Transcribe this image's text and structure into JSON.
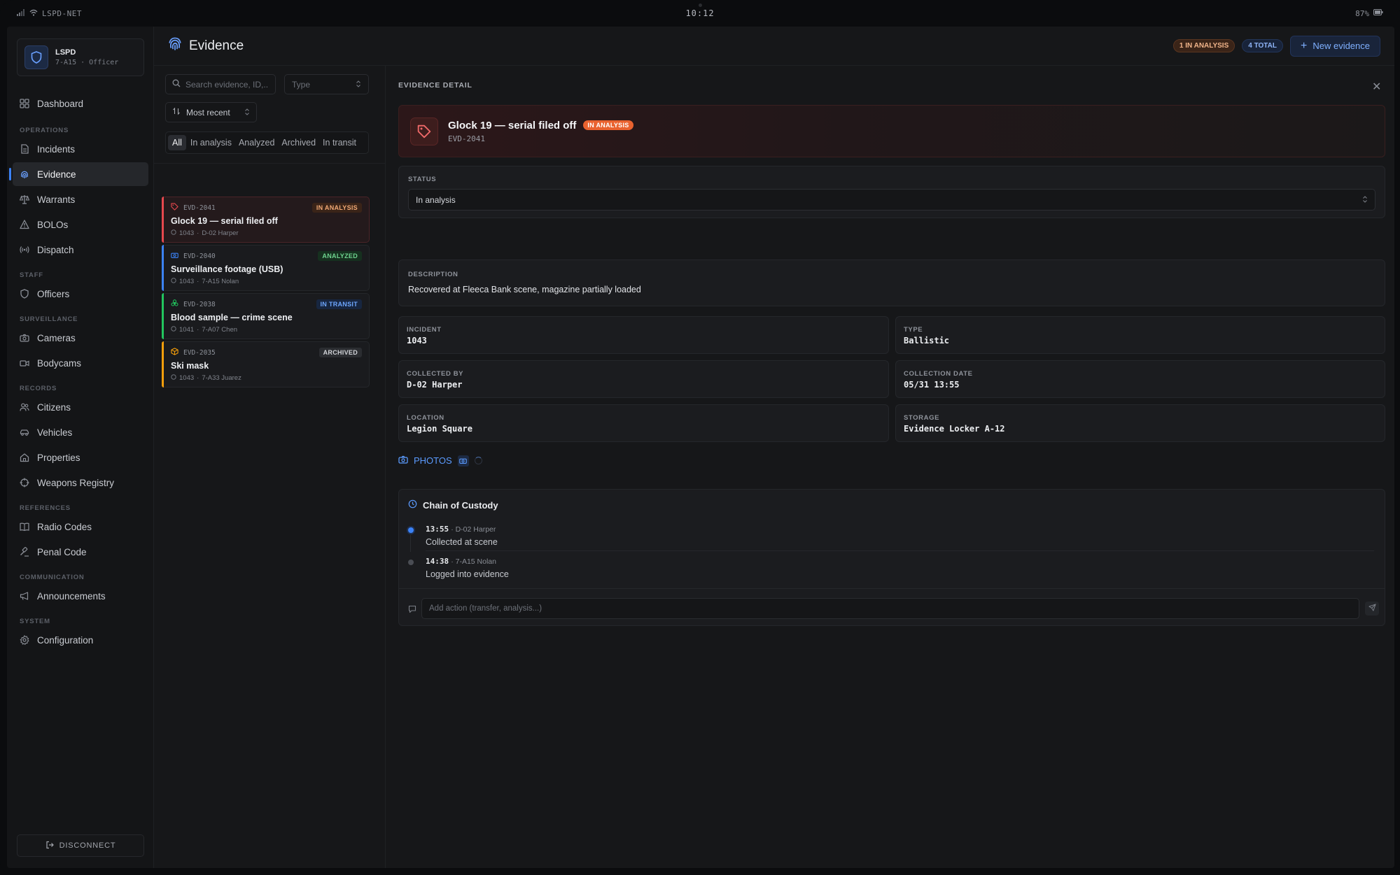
{
  "statusbar": {
    "network": "LSPD-NET",
    "time": "10:12",
    "battery": "87%"
  },
  "brand": {
    "title": "LSPD",
    "subtitle": "7-A15 · Officer"
  },
  "sidebar": {
    "dashboard": "Dashboard",
    "sections": {
      "operations": "OPERATIONS",
      "staff": "STAFF",
      "surveillance": "SURVEILLANCE",
      "records": "RECORDS",
      "references": "REFERENCES",
      "communication": "COMMUNICATION",
      "system": "SYSTEM"
    },
    "items": {
      "incidents": "Incidents",
      "evidence": "Evidence",
      "warrants": "Warrants",
      "bolos": "BOLOs",
      "dispatch": "Dispatch",
      "officers": "Officers",
      "cameras": "Cameras",
      "bodycams": "Bodycams",
      "citizens": "Citizens",
      "vehicles": "Vehicles",
      "properties": "Properties",
      "weapons": "Weapons Registry",
      "radio": "Radio Codes",
      "penal": "Penal Code",
      "announcements": "Announcements",
      "configuration": "Configuration"
    },
    "disconnect": "DISCONNECT"
  },
  "header": {
    "title": "Evidence",
    "in_analysis": "1 IN ANALYSIS",
    "total": "4 TOTAL",
    "new_button": "New evidence"
  },
  "filters": {
    "search_placeholder": "Search evidence, ID,...",
    "type_placeholder": "Type",
    "sort": "Most recent",
    "tabs": [
      "All",
      "In analysis",
      "Analyzed",
      "Archived",
      "In transit"
    ]
  },
  "evidence_list": [
    {
      "id": "EVD-2041",
      "title": "Glock 19 — serial filed off",
      "incident": "1043",
      "officer": "D-02 Harper",
      "status": "IN ANALYSIS",
      "color": "#e5484d"
    },
    {
      "id": "EVD-2040",
      "title": "Surveillance footage (USB)",
      "incident": "1043",
      "officer": "7-A15 Nolan",
      "status": "ANALYZED",
      "color": "#3b82f6"
    },
    {
      "id": "EVD-2038",
      "title": "Blood sample — crime scene",
      "incident": "1041",
      "officer": "7-A07 Chen",
      "status": "IN TRANSIT",
      "color": "#22c55e"
    },
    {
      "id": "EVD-2035",
      "title": "Ski mask",
      "incident": "1043",
      "officer": "7-A33 Juarez",
      "status": "ARCHIVED",
      "color": "#f59e0b"
    }
  ],
  "detail": {
    "section_title": "EVIDENCE DETAIL",
    "title": "Glock 19 — serial filed off",
    "badge": "IN ANALYSIS",
    "id": "EVD-2041",
    "status_label": "STATUS",
    "status_value": "In analysis",
    "description_label": "DESCRIPTION",
    "description": "Recovered at Fleeca Bank scene, magazine partially loaded",
    "fields": {
      "incident_label": "INCIDENT",
      "incident": "1043",
      "type_label": "TYPE",
      "type": "Ballistic",
      "collected_by_label": "COLLECTED BY",
      "collected_by": "D-02 Harper",
      "collection_date_label": "COLLECTION DATE",
      "collection_date": "05/31 13:55",
      "location_label": "LOCATION",
      "location": "Legion Square",
      "storage_label": "STORAGE",
      "storage": "Evidence Locker A-12"
    },
    "photos_label": "PHOTOS",
    "custody_title": "Chain of Custody",
    "custody": [
      {
        "time": "13:55",
        "officer": "· D-02 Harper",
        "action": "Collected at scene"
      },
      {
        "time": "14:38",
        "officer": "· 7-A15 Nolan",
        "action": "Logged into evidence"
      }
    ],
    "action_placeholder": "Add action (transfer, analysis...)"
  }
}
